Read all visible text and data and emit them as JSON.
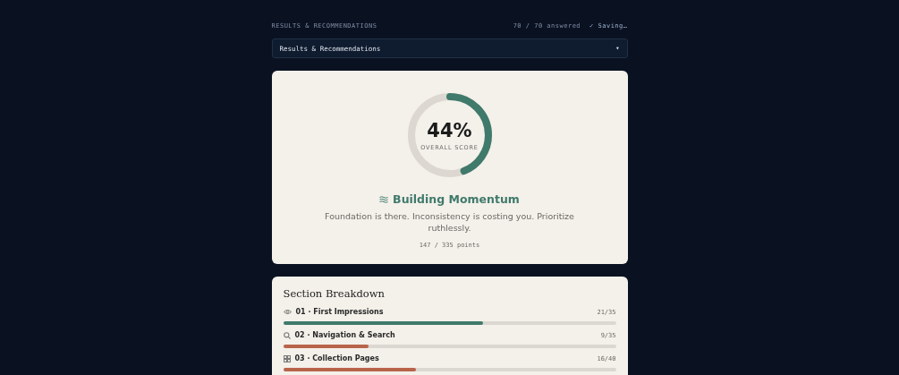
{
  "header": {
    "title": "RESULTS & RECOMMENDATIONS",
    "progress": "70 / 70 answered",
    "save_status": "✓ Saving…"
  },
  "section_select": {
    "value": "Results & Recommendations",
    "caret": "▾"
  },
  "score": {
    "percent": "44%",
    "label": "OVERALL SCORE",
    "level": 0.44,
    "tier": "Building Momentum",
    "summary": "Foundation is there. Inconsistency is costing you. Prioritize ruthlessly.",
    "points": "147 / 335 points"
  },
  "breakdown": {
    "title": "Section Breakdown",
    "sections": [
      {
        "name": "01 · First Impressions",
        "score": "21/35",
        "level": 0.6,
        "color": "#3f7a6b"
      },
      {
        "name": "02 · Navigation & Search",
        "score": "9/35",
        "level": 0.257,
        "color": "#b8644a"
      },
      {
        "name": "03 · Collection Pages",
        "score": "16/40",
        "level": 0.4,
        "color": "#b8644a"
      }
    ]
  }
}
